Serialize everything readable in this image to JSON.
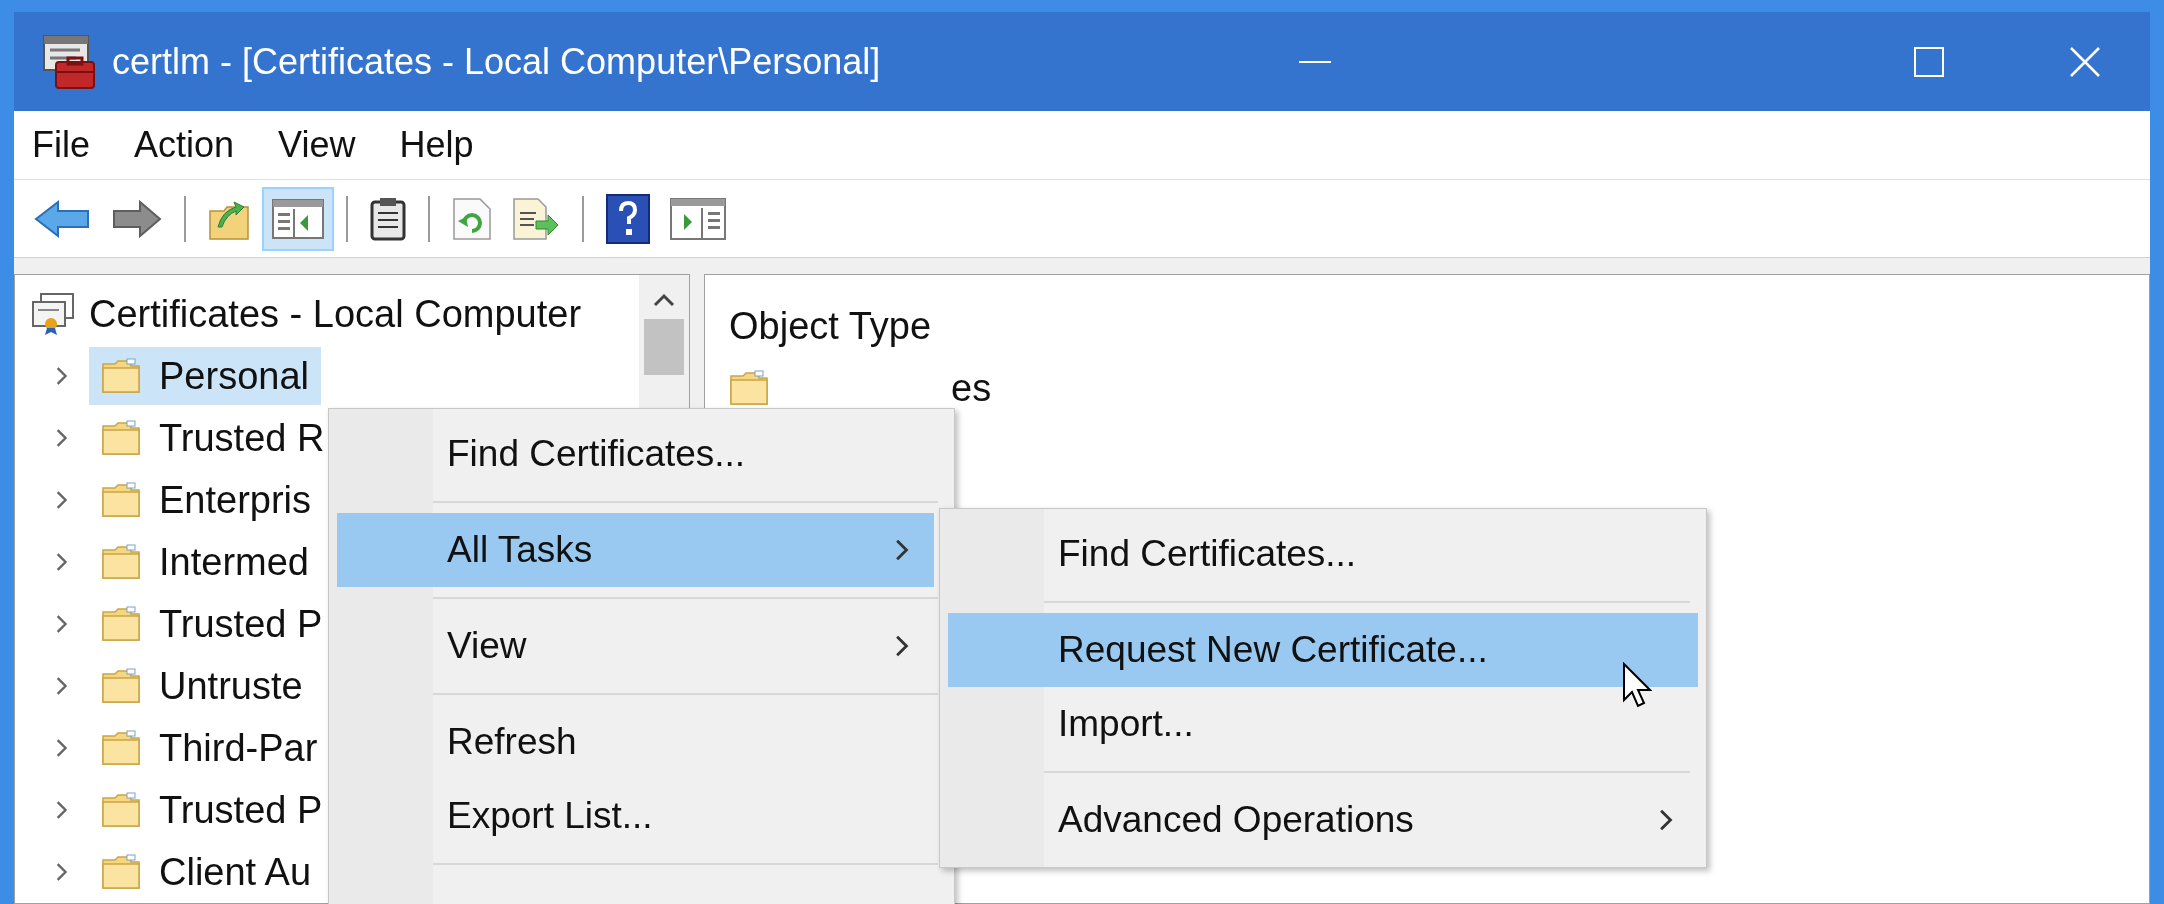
{
  "window": {
    "title": "certlm - [Certificates - Local Computer\\Personal]"
  },
  "menu_bar": [
    {
      "label": "File"
    },
    {
      "label": "Action"
    },
    {
      "label": "View"
    },
    {
      "label": "Help"
    }
  ],
  "toolbar": {
    "buttons": [
      {
        "pressed": false
      },
      {
        "pressed": false
      },
      {
        "pressed": false
      },
      {
        "pressed": true
      },
      {
        "pressed": false
      },
      {
        "pressed": false
      },
      {
        "pressed": false
      },
      {
        "pressed": false
      },
      {
        "pressed": false
      }
    ]
  },
  "tree": {
    "root": {
      "label": "Certificates - Local Computer"
    },
    "items": [
      {
        "label": "Personal",
        "selected": true,
        "expanded": false
      },
      {
        "label": "Trusted R",
        "selected": false,
        "expanded": false
      },
      {
        "label": "Enterpris",
        "selected": false,
        "expanded": false
      },
      {
        "label": "Intermed",
        "selected": false,
        "expanded": false
      },
      {
        "label": "Trusted P",
        "selected": false,
        "expanded": false
      },
      {
        "label": "Untruste",
        "selected": false,
        "expanded": false
      },
      {
        "label": "Third-Par",
        "selected": false,
        "expanded": false
      },
      {
        "label": "Trusted P",
        "selected": false,
        "expanded": false
      },
      {
        "label": "Client Au",
        "selected": false,
        "expanded": false
      }
    ]
  },
  "details": {
    "column_header": "Object Type",
    "rows": [
      {
        "name": "es"
      }
    ]
  },
  "context_menu": {
    "items": [
      {
        "kind": "item",
        "label": "Find Certificates...",
        "submenu": false,
        "selected": false
      },
      {
        "kind": "separator"
      },
      {
        "kind": "item",
        "label": "All Tasks",
        "submenu": true,
        "selected": true
      },
      {
        "kind": "separator"
      },
      {
        "kind": "item",
        "label": "View",
        "submenu": true,
        "selected": false
      },
      {
        "kind": "separator"
      },
      {
        "kind": "item",
        "label": "Refresh",
        "submenu": false,
        "selected": false
      },
      {
        "kind": "item",
        "label": "Export List...",
        "submenu": false,
        "selected": false
      },
      {
        "kind": "separator"
      }
    ]
  },
  "submenu": {
    "items": [
      {
        "kind": "item",
        "label": "Find Certificates...",
        "submenu": false,
        "selected": false
      },
      {
        "kind": "separator"
      },
      {
        "kind": "item",
        "label": "Request New Certificate...",
        "submenu": false,
        "selected": true
      },
      {
        "kind": "item",
        "label": "Import...",
        "submenu": false,
        "selected": false
      },
      {
        "kind": "separator"
      },
      {
        "kind": "item",
        "label": "Advanced Operations",
        "submenu": true,
        "selected": false
      }
    ]
  }
}
